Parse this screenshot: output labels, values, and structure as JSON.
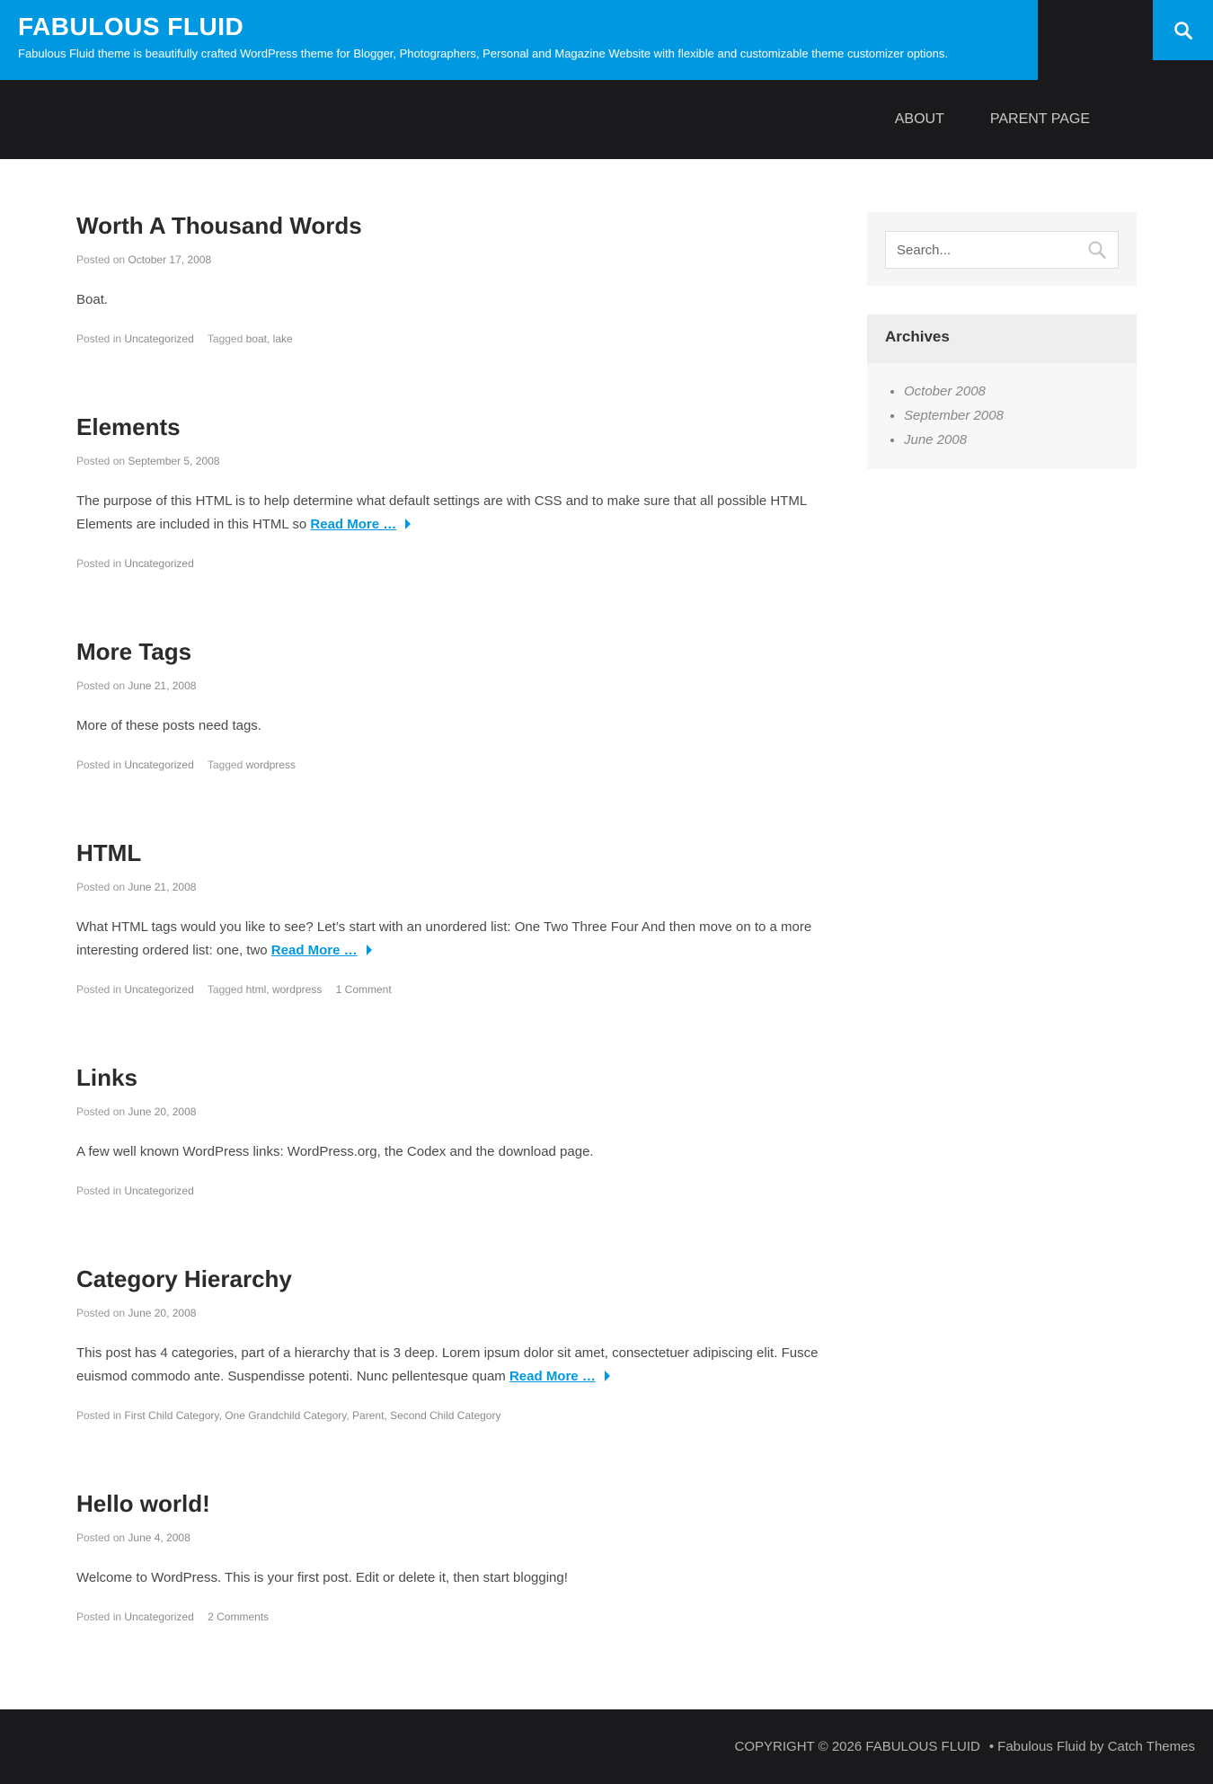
{
  "site": {
    "title": "FABULOUS FLUID",
    "description": "Fabulous Fluid theme is beautifully crafted WordPress theme for Blogger, Photographers, Personal and Magazine Website with flexible and customizable theme customizer options.",
    "accent_color": "#0099e1",
    "header_bg": "#1a1a1c"
  },
  "nav": {
    "items": [
      "ABOUT",
      "PARENT PAGE"
    ]
  },
  "search": {
    "placeholder": "Search..."
  },
  "archives": {
    "title": "Archives",
    "items": [
      "October 2008",
      "September 2008",
      "June 2008"
    ]
  },
  "posts": [
    {
      "title": "Worth A Thousand Words",
      "posted_label": "Posted on",
      "date": "October 17, 2008",
      "body": "Boat.",
      "read_more": "",
      "cat_label": "Posted in",
      "categories": "Uncategorized",
      "tag_label": "Tagged",
      "tags": "boat, lake",
      "comments": ""
    },
    {
      "title": "Elements",
      "posted_label": "Posted on",
      "date": "September 5, 2008",
      "body": "The purpose of this HTML is to help determine what default settings are with CSS and to make sure that all possible HTML Elements are included in this HTML so",
      "read_more": "Read More …",
      "cat_label": "Posted in",
      "categories": "Uncategorized",
      "tag_label": "",
      "tags": "",
      "comments": ""
    },
    {
      "title": "More Tags",
      "posted_label": "Posted on",
      "date": "June 21, 2008",
      "body": "More of these posts need tags.",
      "read_more": "",
      "cat_label": "Posted in",
      "categories": "Uncategorized",
      "tag_label": "Tagged",
      "tags": "wordpress",
      "comments": ""
    },
    {
      "title": "HTML",
      "posted_label": "Posted on",
      "date": "June 21, 2008",
      "body": "What HTML tags would you like to see? Let’s start with an unordered list: One Two Three Four And then move on to a more interesting ordered list: one, two",
      "read_more": "Read More …",
      "cat_label": "Posted in",
      "categories": "Uncategorized",
      "tag_label": "Tagged",
      "tags": "html, wordpress",
      "comments": "1 Comment"
    },
    {
      "title": "Links",
      "posted_label": "Posted on",
      "date": "June 20, 2008",
      "body": "A few well known WordPress links: WordPress.org, the Codex and the download page.",
      "read_more": "",
      "cat_label": "Posted in",
      "categories": "Uncategorized",
      "tag_label": "",
      "tags": "",
      "comments": ""
    },
    {
      "title": "Category Hierarchy",
      "posted_label": "Posted on",
      "date": "June 20, 2008",
      "body": "This post has 4 categories, part of a hierarchy that is 3 deep. Lorem ipsum dolor sit amet, consectetuer adipiscing elit. Fusce euismod commodo ante. Suspendisse potenti. Nunc pellentesque quam",
      "read_more": "Read More …",
      "cat_label": "Posted in",
      "categories": "First Child Category, One Grandchild Category, Parent, Second Child Category",
      "tag_label": "",
      "tags": "",
      "comments": ""
    },
    {
      "title": "Hello world!",
      "posted_label": "Posted on",
      "date": "June 4, 2008",
      "body": "Welcome to WordPress. This is your first post. Edit or delete it, then start blogging!",
      "read_more": "",
      "cat_label": "Posted in",
      "categories": "Uncategorized",
      "tag_label": "",
      "tags": "",
      "comments": "2 Comments"
    }
  ],
  "footer": {
    "copyright": "COPYRIGHT © 2026 FABULOUS FLUID",
    "bullet": "•",
    "credit": "Fabulous Fluid by Catch Themes"
  }
}
